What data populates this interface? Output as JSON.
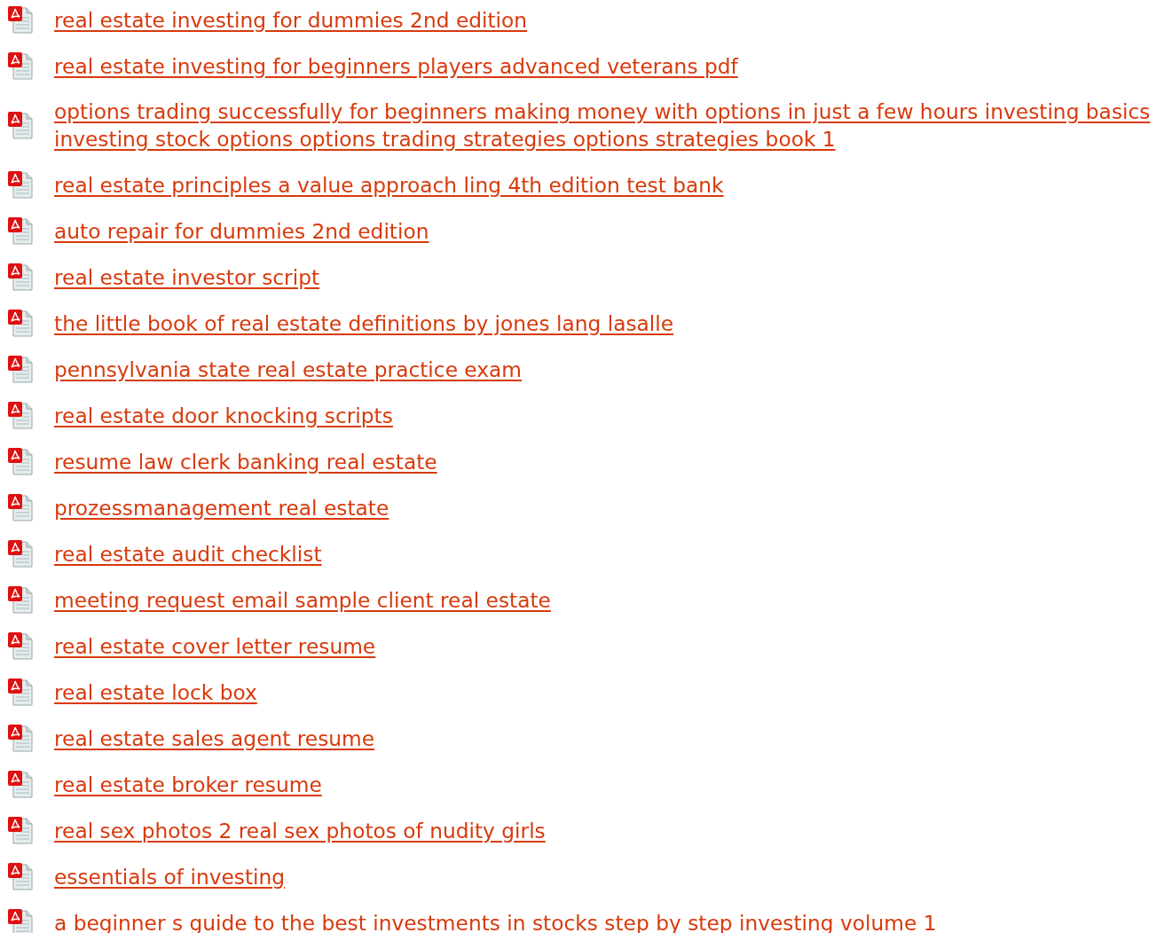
{
  "documents": [
    {
      "title": "real estate investing for dummies 2nd edition"
    },
    {
      "title": "real estate investing for beginners players advanced veterans pdf"
    },
    {
      "title": "options trading successfully for beginners making money with options in just a few hours investing basics investing stock options options trading strategies options strategies book 1"
    },
    {
      "title": "real estate principles a value approach ling 4th edition test bank"
    },
    {
      "title": "auto repair for dummies 2nd edition"
    },
    {
      "title": "real estate investor script"
    },
    {
      "title": "the little book of real estate definitions by jones lang lasalle"
    },
    {
      "title": "pennsylvania state real estate practice exam"
    },
    {
      "title": "real estate door knocking scripts"
    },
    {
      "title": "resume law clerk banking real estate"
    },
    {
      "title": "prozessmanagement real estate"
    },
    {
      "title": "real estate audit checklist"
    },
    {
      "title": "meeting request email sample client real estate"
    },
    {
      "title": "real estate cover letter resume"
    },
    {
      "title": "real estate lock box"
    },
    {
      "title": "real estate sales agent resume"
    },
    {
      "title": "real estate broker resume"
    },
    {
      "title": "real sex photos 2 real sex photos of nudity girls"
    },
    {
      "title": "essentials of investing"
    },
    {
      "title": "a beginner s guide to the best investments in stocks step by step investing volume 1"
    }
  ]
}
